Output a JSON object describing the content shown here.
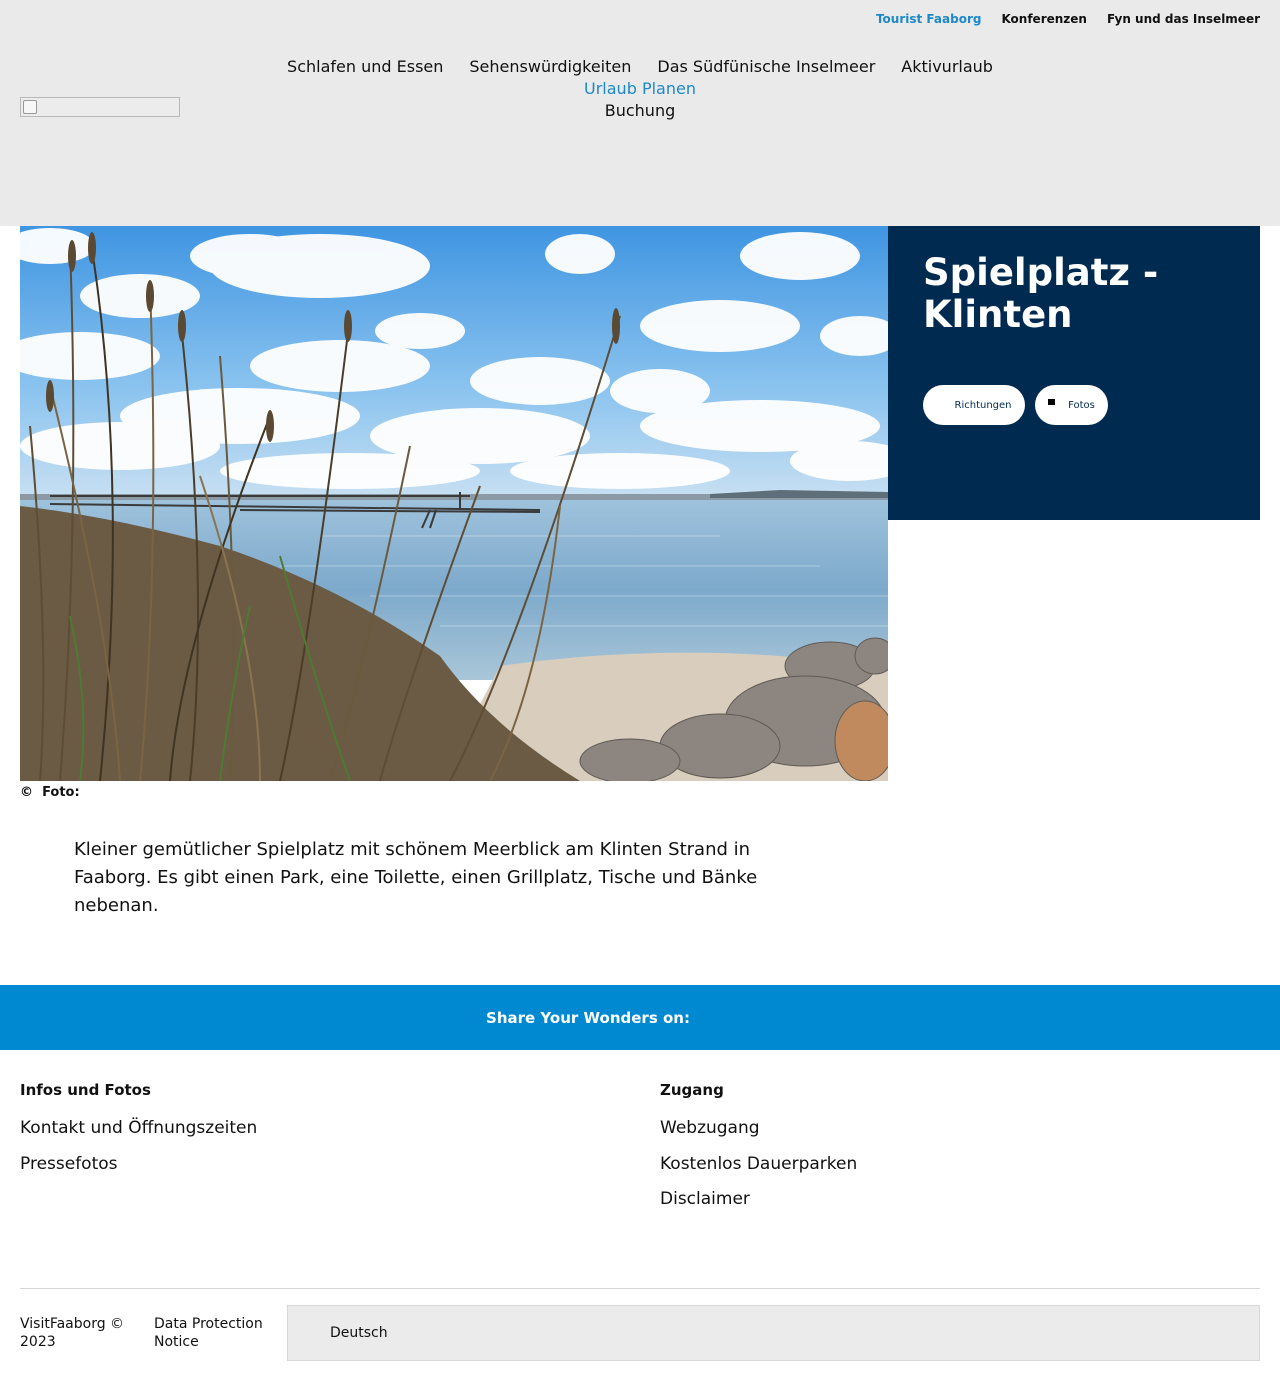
{
  "header": {
    "top_links": [
      "Tourist Faaborg",
      "Konferenzen",
      "Fyn und das Inselmeer"
    ],
    "main_links": [
      "Schlafen und Essen",
      "Sehenswürdigkeiten",
      "Das Südfünische Inselmeer",
      "Aktivurlaub",
      "Urlaub Planen",
      "Buchung"
    ],
    "accent_color": "#1e88c8"
  },
  "hero": {
    "caption_icon": "©",
    "caption_label": "Foto:"
  },
  "infobox": {
    "title": "Spielplatz - Klinten",
    "btn_directions": "Richtungen",
    "btn_photos": "Fotos",
    "bg_color": "#002a4f"
  },
  "description": "Kleiner gemütlicher Spielplatz mit schönem Meerblick am Klinten Strand in Faaborg. Es gibt einen Park, eine Toilette, einen Grillplatz, Tische und Bänke nebenan.",
  "share": {
    "text": "Share Your Wonders on:",
    "bg_color": "#0089d1"
  },
  "footer": {
    "left": {
      "heading": "Infos und Fotos",
      "links": [
        "Kontakt und Öffnungszeiten",
        "Pressefotos"
      ]
    },
    "right": {
      "heading": "Zugang",
      "links": [
        "Webzugang",
        "Kostenlos Dauerparken",
        "Disclaimer"
      ]
    },
    "copyright": "VisitFaaborg © 2023",
    "privacy": "Data Protection Notice",
    "language": "Deutsch"
  }
}
